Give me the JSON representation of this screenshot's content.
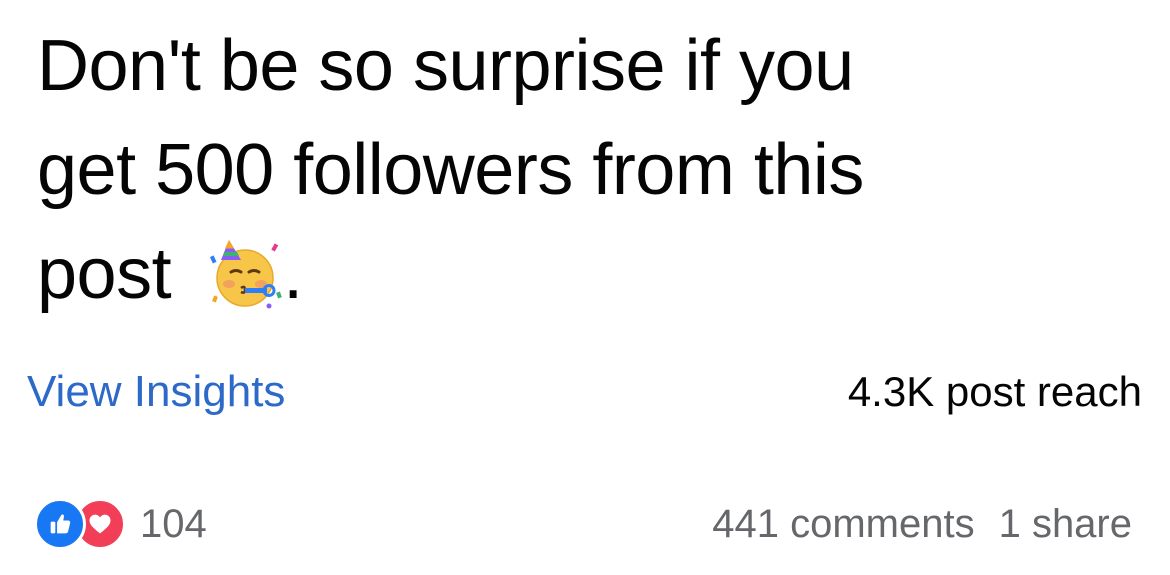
{
  "post": {
    "text_line_1": "Don't be so surprise if you",
    "text_line_2": "get 500 followers from this",
    "text_line_3": "post",
    "text_suffix": ".",
    "emoji_name": "partying-face-icon"
  },
  "insights": {
    "link_label": "View Insights",
    "reach_label": "4.3K post reach"
  },
  "stats": {
    "reaction_icons": [
      "like-icon",
      "love-icon"
    ],
    "reaction_count": "104",
    "comments_label": "441 comments",
    "shares_label": "1 share"
  },
  "colors": {
    "link": "#2d69c8",
    "like": "#1877f2",
    "love": "#f33e58",
    "secondary_text": "#65676b"
  }
}
